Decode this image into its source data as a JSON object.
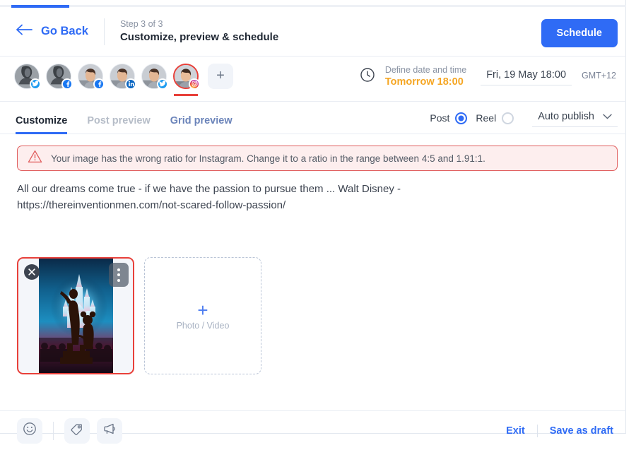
{
  "header": {
    "go_back_label": "Go Back",
    "step_count": "Step 3 of 3",
    "step_title": "Customize, preview & schedule",
    "schedule_label": "Schedule",
    "progress_percent": 9
  },
  "accounts": {
    "add_label": "+",
    "items": [
      {
        "name": "account-twitter-1",
        "network": "twitter",
        "badge": "twitter-icon",
        "avatar_kind": "logo",
        "selected": false
      },
      {
        "name": "account-facebook-1",
        "network": "facebook",
        "badge": "facebook-icon",
        "avatar_kind": "logo",
        "selected": false
      },
      {
        "name": "account-facebook-2",
        "network": "facebook",
        "badge": "facebook-icon",
        "avatar_kind": "photo",
        "selected": false
      },
      {
        "name": "account-linkedin-1",
        "network": "linkedin",
        "badge": "linkedin-icon",
        "avatar_kind": "photo",
        "selected": false
      },
      {
        "name": "account-twitter-2",
        "network": "twitter",
        "badge": "twitter-icon",
        "avatar_kind": "photo",
        "selected": false
      },
      {
        "name": "account-instagram-1",
        "network": "instagram",
        "badge": "instagram-icon",
        "avatar_kind": "photo",
        "selected": true
      }
    ]
  },
  "schedule": {
    "define_label": "Define date and time",
    "relative_label": "Tomorrow 18:00",
    "datetime_value": "Fri, 19 May 18:00",
    "timezone": "GMT+12",
    "accent_color": "#f5a623"
  },
  "tabs": [
    {
      "label": "Customize",
      "state": "active"
    },
    {
      "label": "Post preview",
      "state": "muted"
    },
    {
      "label": "Grid preview",
      "state": "link"
    }
  ],
  "post_type": {
    "post_label": "Post",
    "reel_label": "Reel",
    "selected": "Post",
    "publish_mode": "Auto publish"
  },
  "warning": {
    "icon": "warning-triangle-icon",
    "text": "Your image has the wrong ratio for Instagram. Change it to a ratio in the range between 4:5 and 1.91:1.",
    "border_color": "#e05c5c",
    "background_color": "#fdeeee"
  },
  "composer": {
    "caption": "All our dreams come true - if we have the passion to pursue them ... Walt Disney - https://thereinventionmen.com/not-scared-follow-passion/"
  },
  "media": {
    "attachment_alt": "Walt Disney and Mickey Mouse statue in front of illuminated castle",
    "has_error": true,
    "error_border_color": "#e8403a",
    "remove_icon": "close-icon",
    "menu_icon": "more-options-icon",
    "add_plus": "+",
    "add_label": "Photo / Video"
  },
  "footer": {
    "tools": [
      {
        "name": "emoji-icon",
        "label": "Emoji"
      },
      {
        "name": "tag-icon",
        "label": "Tag"
      },
      {
        "name": "megaphone-icon",
        "label": "Promote"
      }
    ],
    "exit_label": "Exit",
    "save_draft_label": "Save as draft"
  },
  "theme": {
    "primary": "#2f6bf5",
    "danger": "#e8403a",
    "warning": "#f5a623"
  }
}
